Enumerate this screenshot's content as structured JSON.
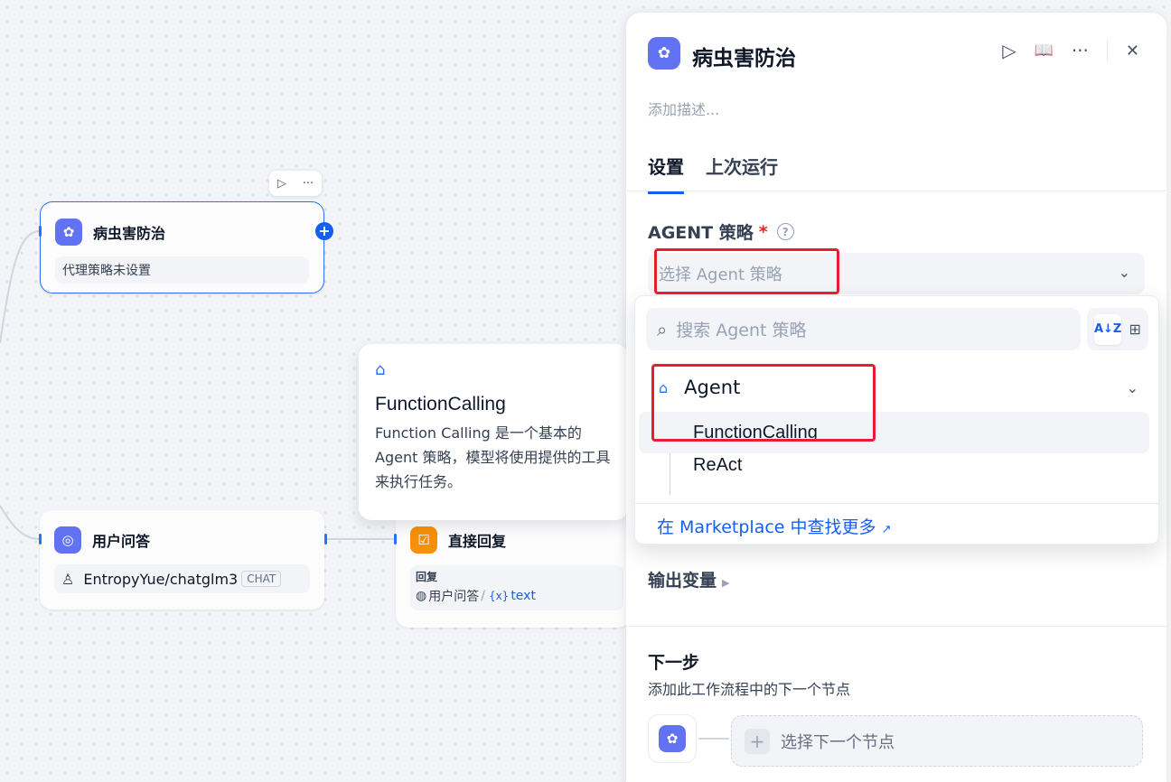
{
  "canvas": {
    "agent_node": {
      "title": "病虫害防治",
      "subtitle": "代理策略未设置"
    },
    "qa_node": {
      "title": "用户问答",
      "model": "EntropyYue/chatglm3",
      "badge": "CHAT"
    },
    "answer_node": {
      "title": "直接回复",
      "reply_label": "回复",
      "var_source": "用户问答",
      "var_sep": "/",
      "var_icon": "{x}",
      "var_name": "text"
    },
    "mini_toolbar": {
      "run_icon": "▷",
      "more_icon": "···"
    },
    "add_handle": "+"
  },
  "tooltip": {
    "title": "FunctionCalling",
    "description": "Function Calling 是一个基本的 Agent 策略，模型将使用提供的工具来执行任务。"
  },
  "panel": {
    "title": "病虫害防治",
    "description_placeholder": "添加描述...",
    "tabs": [
      {
        "label": "设置",
        "active": true
      },
      {
        "label": "上次运行",
        "active": false
      }
    ],
    "strategy_label": "AGENT 策略",
    "required_mark": "*",
    "help_icon": "?",
    "strategy_placeholder": "选择 Agent 策略",
    "output_vars_label": "输出变量",
    "next_step_title": "下一步",
    "next_step_desc": "添加此工作流程中的下一个节点",
    "next_step_select": "选择下一个节点",
    "close_icon": "✕",
    "run_icon": "▷",
    "doc_icon": "📖",
    "more_icon": "···"
  },
  "dropdown": {
    "search_placeholder": "搜索 Agent 策略",
    "group_label": "Agent",
    "items": [
      "FunctionCalling",
      "ReAct"
    ],
    "marketplace_link": "在 Marketplace 中查找更多",
    "sort_icon": "A↓Z"
  },
  "colors": {
    "accent": "#155eef",
    "agent_icon": "#6172f3",
    "answer_icon": "#f79009",
    "highlight_red": "#e5202e"
  }
}
